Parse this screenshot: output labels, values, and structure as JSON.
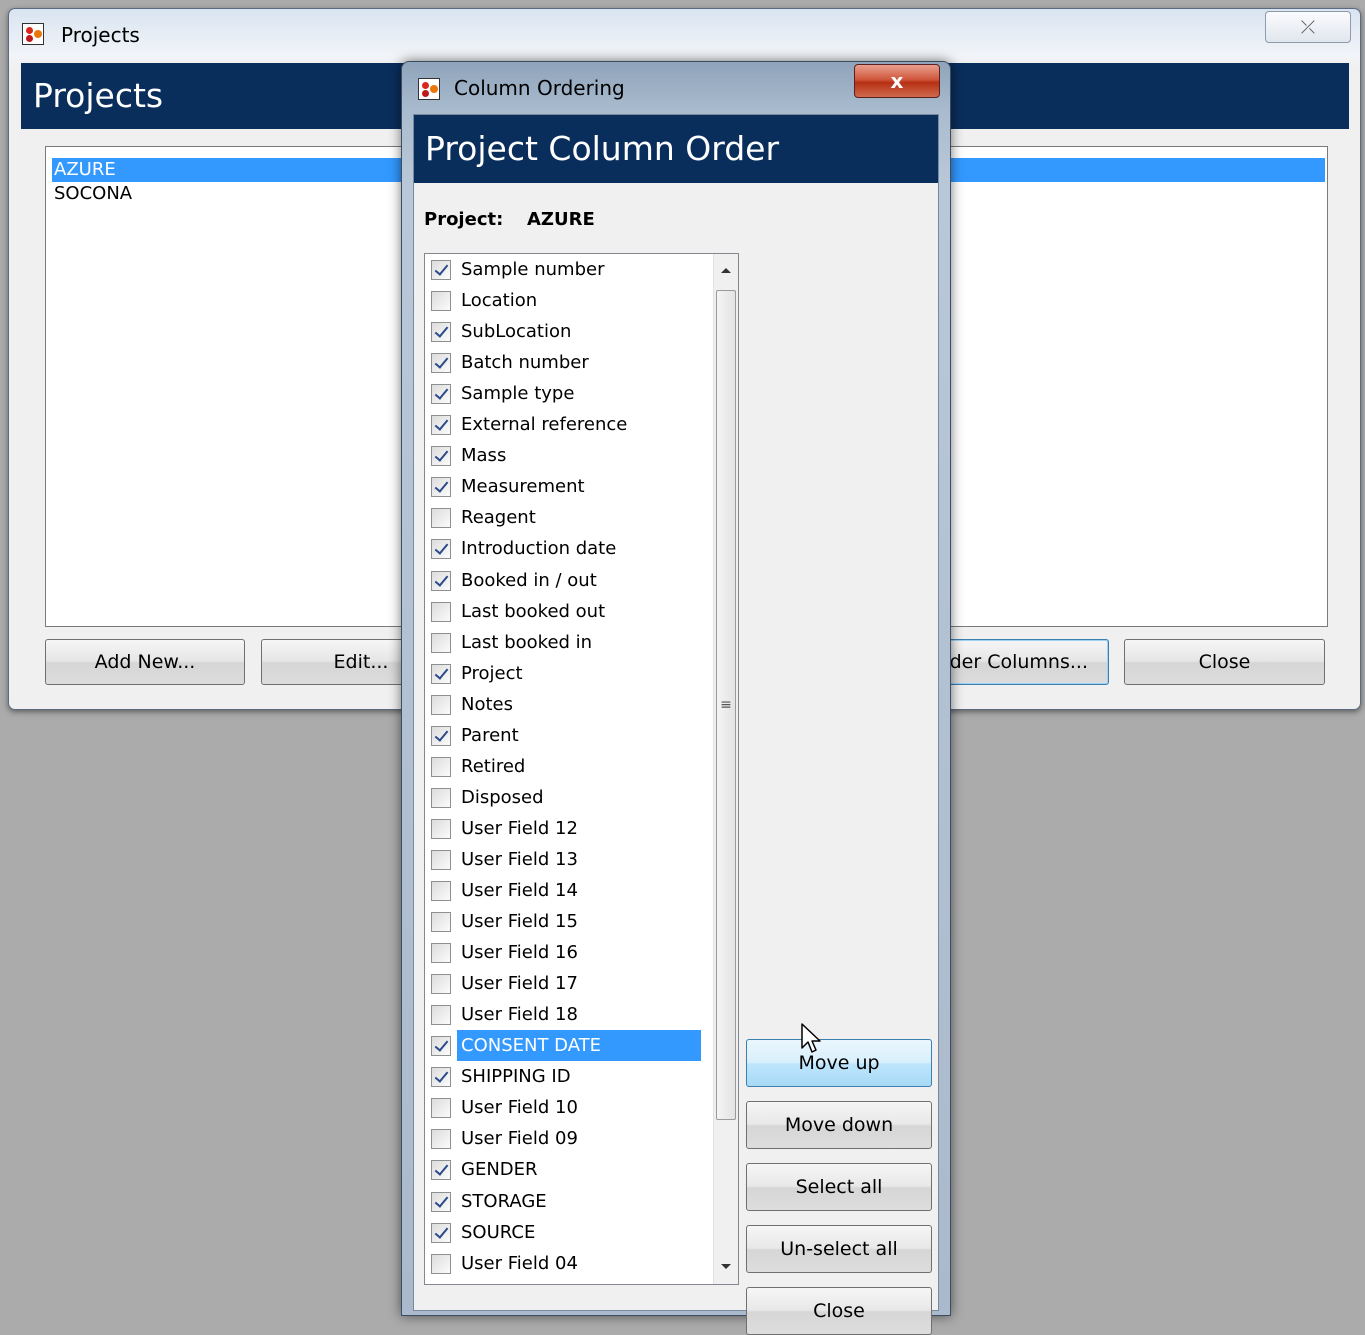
{
  "projects_window": {
    "title": "Projects",
    "close_glyph": "⤫",
    "header": "Projects",
    "list": [
      "AZURE",
      "SOCONA"
    ],
    "selected_index": 0,
    "buttons": {
      "add_new": "Add New...",
      "edit": "Edit...",
      "order_columns": "der Columns...",
      "close": "Close"
    }
  },
  "dialog": {
    "title": "Column Ordering",
    "close_glyph": "x",
    "header": "Project Column Order",
    "project_label": "Project:",
    "project_value": "AZURE",
    "columns": [
      {
        "label": "Sample number",
        "checked": true
      },
      {
        "label": "Location",
        "checked": false
      },
      {
        "label": "SubLocation",
        "checked": true
      },
      {
        "label": "Batch number",
        "checked": true
      },
      {
        "label": "Sample type",
        "checked": true
      },
      {
        "label": "External reference",
        "checked": true
      },
      {
        "label": "Mass",
        "checked": true
      },
      {
        "label": "Measurement",
        "checked": true
      },
      {
        "label": "Reagent",
        "checked": false
      },
      {
        "label": "Introduction date",
        "checked": true
      },
      {
        "label": "Booked in / out",
        "checked": true
      },
      {
        "label": "Last booked out",
        "checked": false
      },
      {
        "label": "Last booked in",
        "checked": false
      },
      {
        "label": "Project",
        "checked": true
      },
      {
        "label": "Notes",
        "checked": false
      },
      {
        "label": "Parent",
        "checked": true
      },
      {
        "label": "Retired",
        "checked": false
      },
      {
        "label": "Disposed",
        "checked": false
      },
      {
        "label": "User Field 12",
        "checked": false
      },
      {
        "label": "User Field 13",
        "checked": false
      },
      {
        "label": "User Field 14",
        "checked": false
      },
      {
        "label": "User Field 15",
        "checked": false
      },
      {
        "label": "User Field 16",
        "checked": false
      },
      {
        "label": "User Field 17",
        "checked": false
      },
      {
        "label": "User Field 18",
        "checked": false
      },
      {
        "label": "CONSENT DATE",
        "checked": true,
        "selected": true
      },
      {
        "label": "SHIPPING ID",
        "checked": true
      },
      {
        "label": "User Field 10",
        "checked": false
      },
      {
        "label": "User Field 09",
        "checked": false
      },
      {
        "label": "GENDER",
        "checked": true
      },
      {
        "label": "STORAGE",
        "checked": true
      },
      {
        "label": "SOURCE",
        "checked": true
      },
      {
        "label": "User Field 04",
        "checked": false
      }
    ],
    "buttons": {
      "move_up": "Move up",
      "move_down": "Move down",
      "select_all": "Select all",
      "unselect_all": "Un-select all",
      "close": "Close"
    },
    "scroll_thumb_glyph": "≡"
  },
  "colors": {
    "header_navy": "#0a2e5c",
    "selection_blue": "#3399ff",
    "desktop_gray": "#ababab"
  }
}
